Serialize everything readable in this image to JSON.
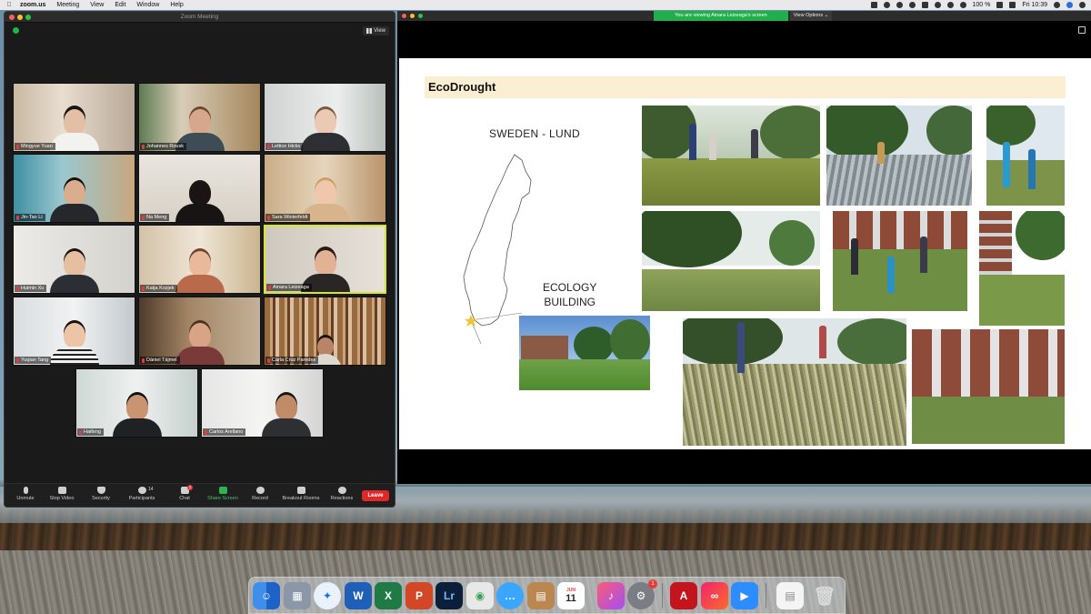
{
  "menubar": {
    "app": "zoom.us",
    "items": [
      "Meeting",
      "View",
      "Edit",
      "Window",
      "Help"
    ],
    "battery": "100 %",
    "clock": "Fri 10:39"
  },
  "zoom": {
    "window_title": "Zoom Meeting",
    "view_label": "View",
    "participants": [
      {
        "name": "Mingyue Yuan"
      },
      {
        "name": "Johannes Rousk"
      },
      {
        "name": "Lettice Hicks"
      },
      {
        "name": "Jin-Tao Li"
      },
      {
        "name": "Na Meng"
      },
      {
        "name": "Sara Winterfeldt"
      },
      {
        "name": "Huimin Xu"
      },
      {
        "name": "Katja Kozjek"
      },
      {
        "name": "Ainara Leizeaga"
      },
      {
        "name": "Yuqian Tang"
      },
      {
        "name": "Dániel Tájmel"
      },
      {
        "name": "Carla Cruz Paredes"
      },
      {
        "name": "Haifeng"
      },
      {
        "name": "Carlos Arellano"
      }
    ],
    "toolbar": {
      "unmute": "Unmute",
      "stop_video": "Stop Video",
      "security": "Security",
      "participants": "Participants",
      "participants_count": "14",
      "chat": "Chat",
      "chat_badge": "1",
      "share_screen": "Share Screen",
      "record": "Record",
      "breakout_rooms": "Breakout Rooms",
      "reactions": "Reactions",
      "leave": "Leave"
    }
  },
  "share": {
    "banner": "You are viewing Ainara Leizeaga's screen",
    "view_options": "View Options ⌄",
    "slide": {
      "title": "EcoDrought",
      "location_label": "SWEDEN - LUND",
      "site_label_line1": "ECOLOGY",
      "site_label_line2": "BUILDING"
    }
  },
  "dock": {
    "calendar_month": "JUN",
    "calendar_day": "11",
    "settings_badge": "1"
  },
  "colors": {
    "zoom_green": "#1fb04b",
    "leave_red": "#e02828",
    "active_speaker": "#d7e62d",
    "slide_title_band": "#fbefd3"
  }
}
